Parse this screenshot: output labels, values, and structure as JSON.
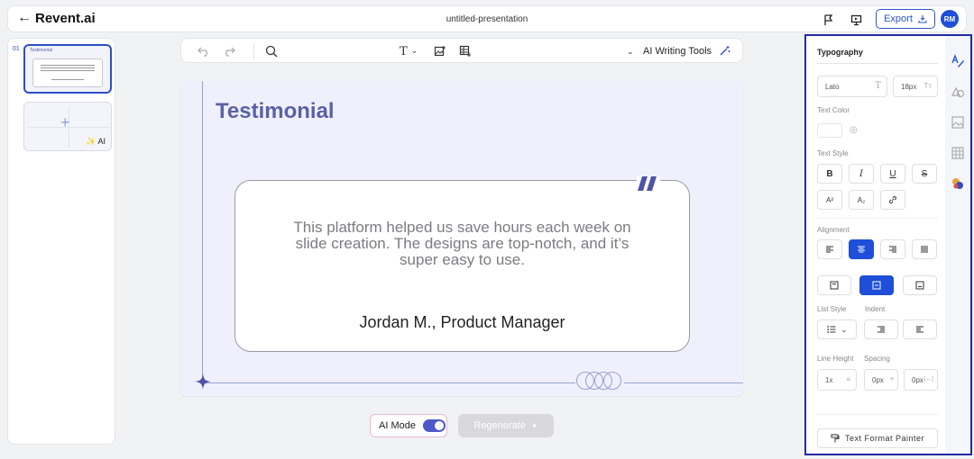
{
  "header": {
    "brand": "Revent.ai",
    "doc_title": "untitled-presentation",
    "export_label": "Export",
    "avatar_initials": "RM"
  },
  "slides_panel": {
    "slide_number": "01",
    "thumb_title": "Testimonial",
    "add_ai_label": "AI"
  },
  "toolbar": {
    "ai_writing_tools_label": "AI Writing Tools",
    "text_tool_glyph": "T"
  },
  "slide": {
    "title": "Testimonial",
    "quote": "This platform helped us save hours each week on slide creation. The designs are top-notch, and it’s super easy to use.",
    "author": "Jordan M., Product Manager"
  },
  "bottom": {
    "ai_mode_label": "AI Mode",
    "ai_mode_on": true,
    "regenerate_label": "Regenerate"
  },
  "typography": {
    "title": "Typography",
    "font_family": "Lato",
    "font_size": "18px",
    "text_color_label": "Text Color",
    "text_style_label": "Text Style",
    "style_buttons": [
      "B",
      "I",
      "U",
      "S"
    ],
    "superscript": "A²",
    "subscript": "A₂",
    "alignment_label": "Alignment",
    "list_style_label": "List Style",
    "indent_label": "Indent",
    "line_height_label": "Line Height",
    "spacing_label": "Spacing",
    "line_height_value": "1x",
    "spacing_value_1": "0px",
    "spacing_value_2": "0px",
    "text_format_painter_label": "Text Format Painter"
  },
  "colors": {
    "accent": "#1f4fd8",
    "slide_title": "#5a61a6",
    "panel_border": "#1f2aa1"
  }
}
